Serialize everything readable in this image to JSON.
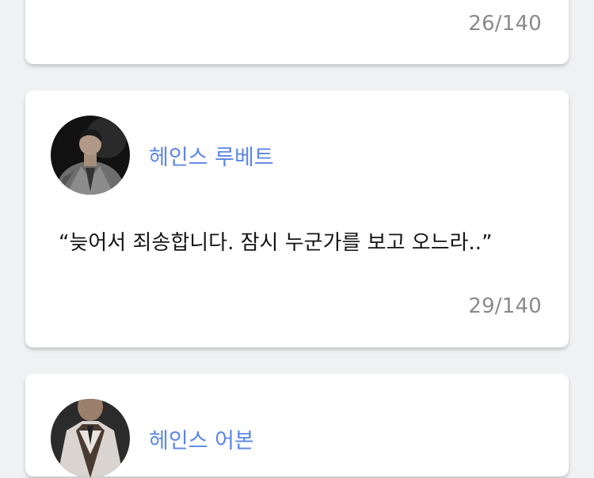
{
  "cards": [
    {
      "counter": "26/140"
    },
    {
      "author": "헤인스 루베트",
      "quote": "“늦어서 죄송합니다. 잠시 누군가를 보고 오느라..”",
      "counter": "29/140",
      "avatar": "avatar-photo"
    },
    {
      "author": "헤인스 어본",
      "avatar": "avatar-photo"
    }
  ],
  "colors": {
    "background": "#f0f1f3",
    "card": "#ffffff",
    "author": "#5c86e6",
    "counter": "#8a8a8a",
    "quote": "#141414"
  }
}
